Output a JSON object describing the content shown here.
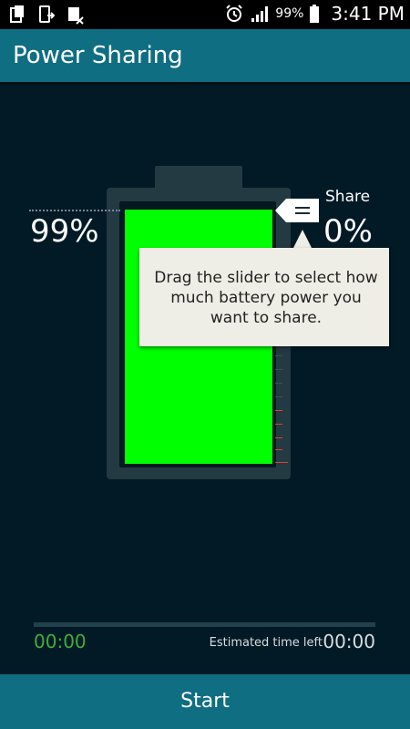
{
  "status_bar": {
    "icons_left": [
      "clipboard-icon",
      "phone-transfer-icon",
      "data-off-icon"
    ],
    "alarm_icon": "alarm-icon",
    "signal_icon": "signal-icon",
    "battery_text": "99%",
    "battery_icon": "battery-icon",
    "time": "3:41 PM"
  },
  "header": {
    "title": "Power Sharing"
  },
  "battery": {
    "level_text": "99%",
    "level_value": 0.99
  },
  "share": {
    "label": "Share",
    "percent_text": "0%",
    "handle_icon": "slider-handle-icon"
  },
  "tooltip": {
    "text": "Drag the slider to select how much battery power you want to share."
  },
  "timer": {
    "elapsed": "00:00",
    "estimated_label": "Estimated time left",
    "estimated_value": "00:00",
    "progress": 0
  },
  "footer": {
    "start_label": "Start"
  },
  "colors": {
    "accent": "#0f6e82",
    "background": "#021a26",
    "battery_fill": "#00ff00",
    "elapsed_text": "#3fae3c"
  }
}
